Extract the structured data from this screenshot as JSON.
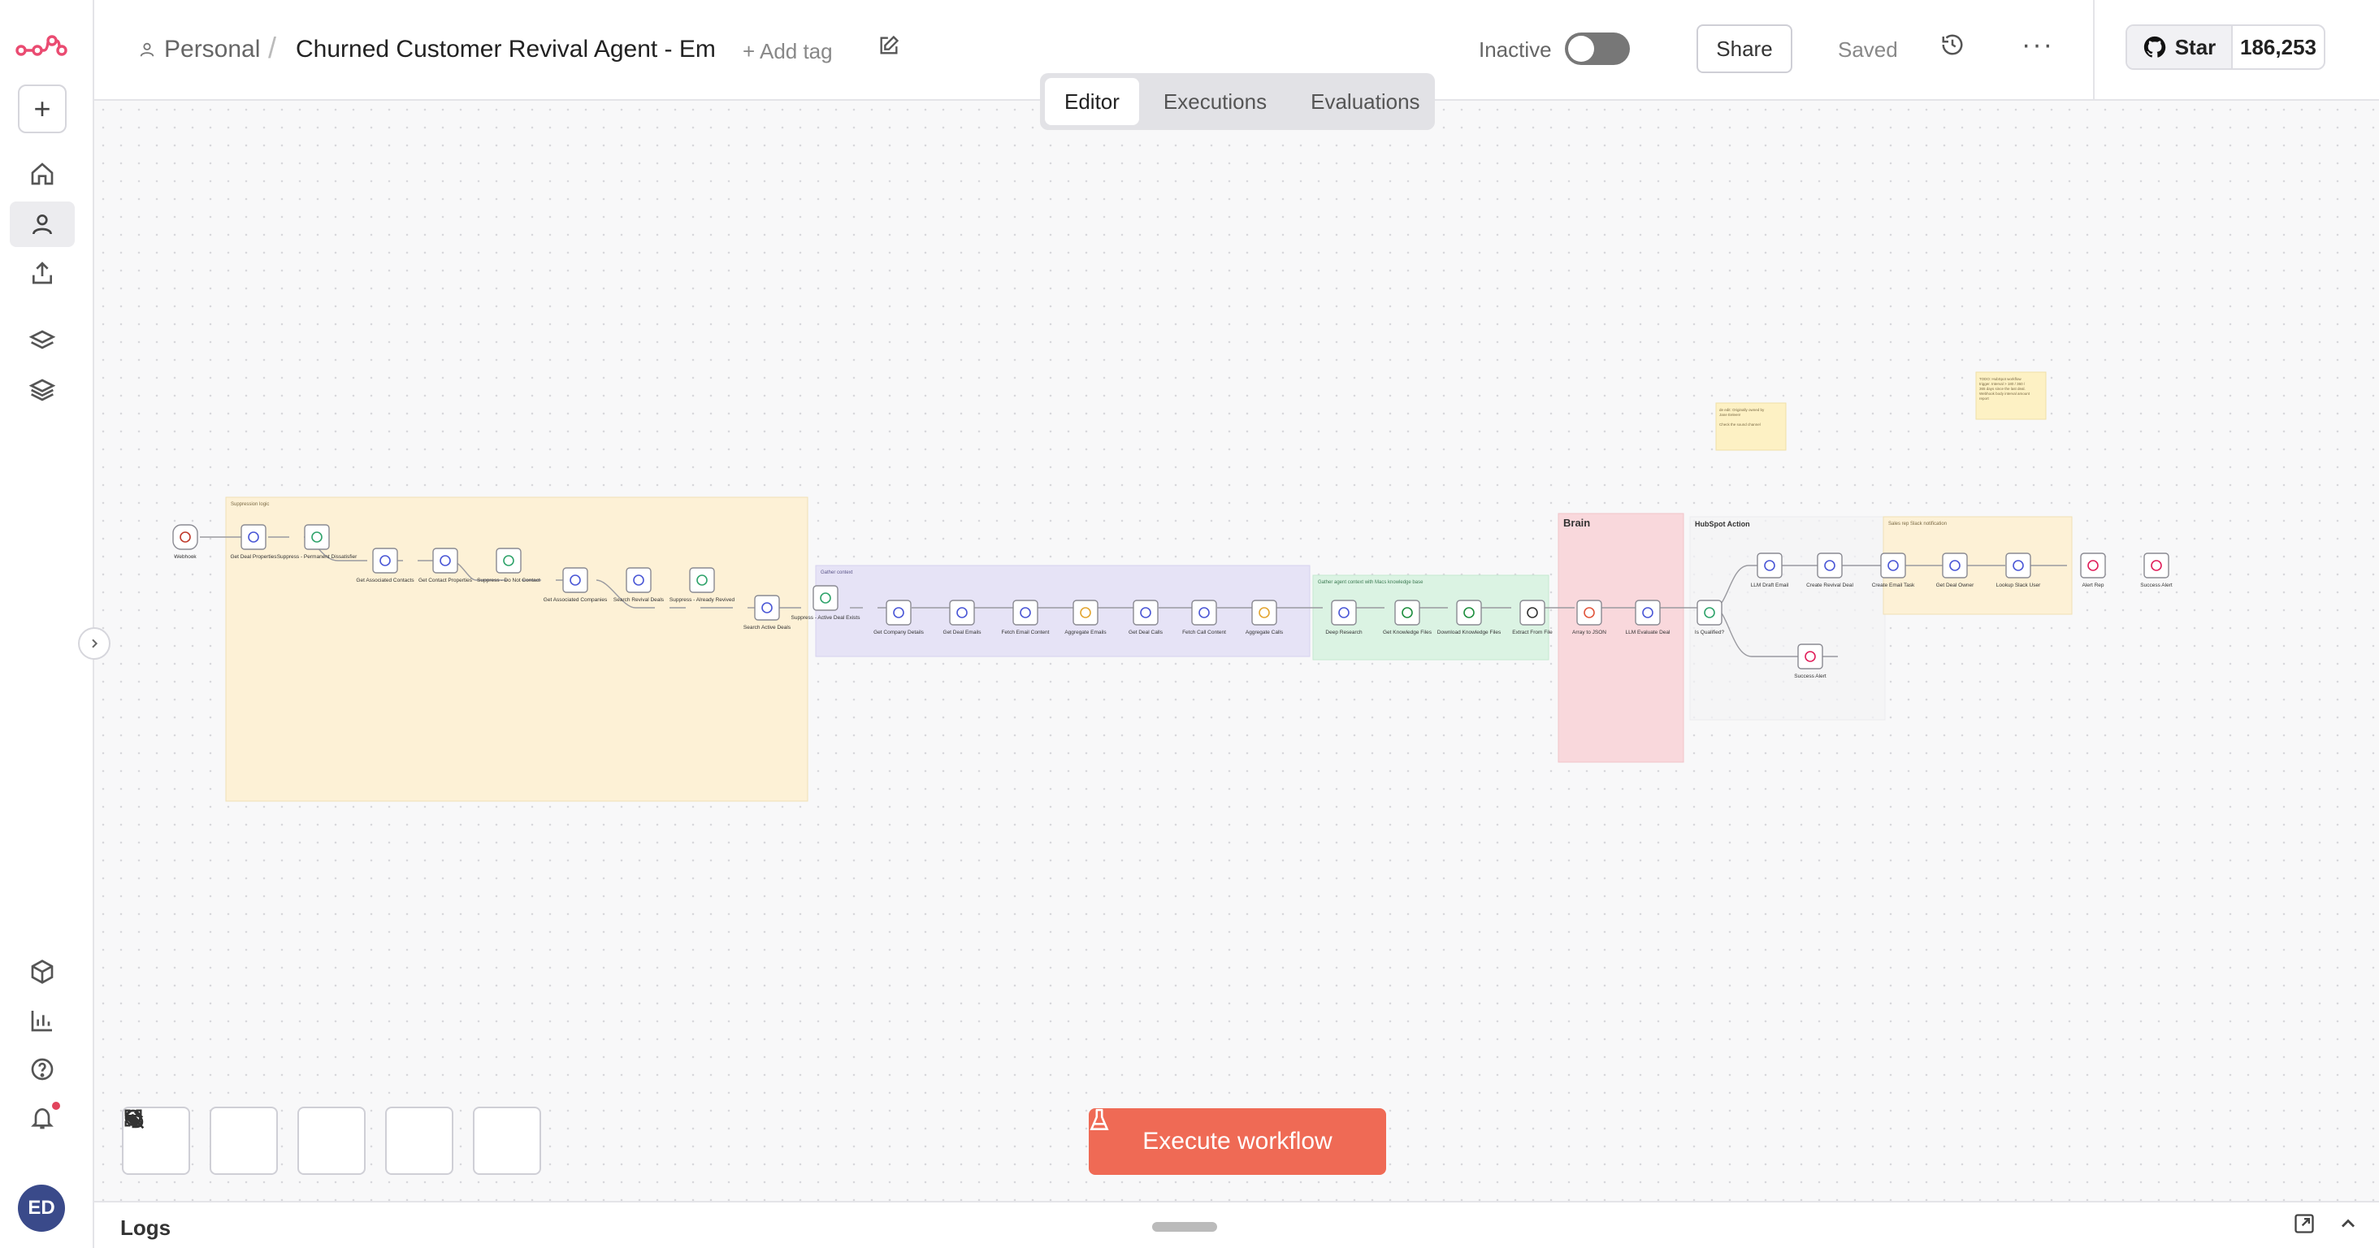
{
  "sidebar": {
    "logo": "n8n-logo",
    "plus_label": "+",
    "avatar_initials": "ED"
  },
  "header": {
    "breadcrumb_personal": "Personal",
    "breadcrumb_sep": "/",
    "workflow_title": "Churned Customer Revival Agent - Em",
    "add_tag": "+ Add tag",
    "status_label": "Inactive",
    "share_label": "Share",
    "saved_label": "Saved",
    "more_label": "···",
    "github_star_label": "Star",
    "github_star_count": "186,253"
  },
  "tabs": [
    {
      "label": "Editor",
      "active": true
    },
    {
      "label": "Executions",
      "active": false
    },
    {
      "label": "Evaluations",
      "active": false
    }
  ],
  "canvas": {
    "groups": [
      {
        "label": "Suppression logic",
        "color": "#fdf1d6"
      },
      {
        "label": "Gather context",
        "color": "#e6e3f6"
      },
      {
        "label": "Gather agent context with Macs knowledge base",
        "color": "#dbf3e3"
      },
      {
        "label": "Brain",
        "color": "#f9d8dc"
      },
      {
        "label": "HubSpot Action",
        "color": "#f9f9fa"
      },
      {
        "label": "Sales rep Slack notification",
        "color": "#fdf1d6"
      }
    ],
    "sticky_notes": [
      {
        "text": "de edit: Originally owned by Jane Eeleen!\n\nCheck the sound channel"
      },
      {
        "text": "TODO: HubSpot workflow trigger. Interval > 180 / 360 / 365 days since the last deal. Webhook body interval amount report"
      }
    ],
    "nodes": [
      {
        "label": "Webhook",
        "kind": "webhook"
      },
      {
        "label": "Get Deal Properties",
        "kind": "http"
      },
      {
        "label": "Suppress - Permanent Dissatisfier",
        "kind": "if"
      },
      {
        "label": "Get Associated Contacts",
        "kind": "http"
      },
      {
        "label": "Get Contact Properties",
        "kind": "http"
      },
      {
        "label": "Suppress - Do Not Contact",
        "kind": "if"
      },
      {
        "label": "Get Associated Companies",
        "kind": "http"
      },
      {
        "label": "Search Revival Deals",
        "kind": "http"
      },
      {
        "label": "Suppress - Already Revived",
        "kind": "if"
      },
      {
        "label": "Search Active Deals",
        "kind": "http"
      },
      {
        "label": "Suppress - Active Deal Exists",
        "kind": "if"
      },
      {
        "label": "Get Company Details",
        "kind": "http"
      },
      {
        "label": "Get Deal Emails",
        "kind": "http"
      },
      {
        "label": "Fetch Email Content",
        "kind": "http"
      },
      {
        "label": "Aggregate Emails",
        "kind": "code"
      },
      {
        "label": "Get Deal Calls",
        "kind": "http"
      },
      {
        "label": "Fetch Call Content",
        "kind": "http"
      },
      {
        "label": "Aggregate Calls",
        "kind": "code"
      },
      {
        "label": "Deep Research",
        "kind": "http"
      },
      {
        "label": "Get Knowledge Files",
        "kind": "drive"
      },
      {
        "label": "Download Knowledge Files",
        "kind": "drive"
      },
      {
        "label": "Extract From File",
        "kind": "file"
      },
      {
        "label": "Array to JSON",
        "kind": "transform"
      },
      {
        "label": "LLM Evaluate Deal",
        "kind": "http"
      },
      {
        "label": "Is Qualified?",
        "kind": "if"
      },
      {
        "label": "LLM Draft Email",
        "kind": "http"
      },
      {
        "label": "Create Revival Deal",
        "kind": "http"
      },
      {
        "label": "Create Email Task",
        "kind": "http"
      },
      {
        "label": "Get Deal Owner",
        "kind": "http"
      },
      {
        "label": "Lookup Slack User",
        "kind": "http"
      },
      {
        "label": "Alert Rep",
        "kind": "slack"
      },
      {
        "label": "Success Alert",
        "kind": "slack"
      },
      {
        "label": "Success Alert",
        "kind": "slack"
      }
    ]
  },
  "execute_button_label": "Execute workflow",
  "logs_label": "Logs",
  "colors": {
    "accent": "#ef6a55",
    "node_http": "#4a57d6",
    "node_if": "#2fa36b",
    "node_code": "#e3a530",
    "node_slack": "#e01e5a"
  }
}
